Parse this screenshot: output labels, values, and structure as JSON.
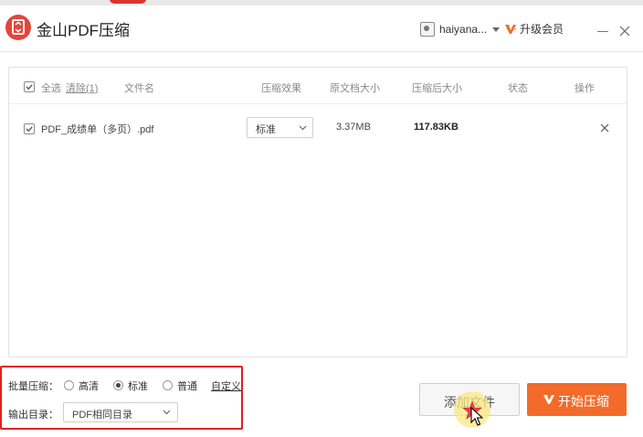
{
  "app": {
    "title": "金山PDF压缩",
    "user_name": "haiyana...",
    "upgrade_label": "升级会员"
  },
  "colors": {
    "brand_red": "#e2463a",
    "accent_orange": "#f26b2a",
    "highlight_red": "#e02020"
  },
  "table": {
    "headers": {
      "select_all": "全选",
      "clear": "清除(1)",
      "filename": "文件名",
      "effect": "压缩效果",
      "original_size": "原文档大小",
      "compressed_size": "压缩后大小",
      "status": "状态",
      "action": "操作"
    },
    "rows": [
      {
        "checked": true,
        "filename": "PDF_成绩单（多页）.pdf",
        "effect": "标准",
        "original_size": "3.37MB",
        "compressed_size": "117.83KB",
        "status": ""
      }
    ]
  },
  "settings": {
    "batch_label": "批量压缩：",
    "options": [
      "高清",
      "标准",
      "普通"
    ],
    "selected_option": "标准",
    "custom_label": "自定义",
    "output_label": "输出目录：",
    "output_value": "PDF相同目录"
  },
  "buttons": {
    "add_file": "添加文件",
    "start": "开始压缩"
  },
  "icons": {
    "app_logo": "pdf-compress-logo-icon",
    "avatar": "user-avatar-icon",
    "upgrade": "vip-v-icon",
    "minimize": "minimize-icon",
    "close": "close-icon",
    "delete_row": "close-icon",
    "dropdown": "chevron-down-icon",
    "cursor": "mouse-cursor-icon"
  }
}
